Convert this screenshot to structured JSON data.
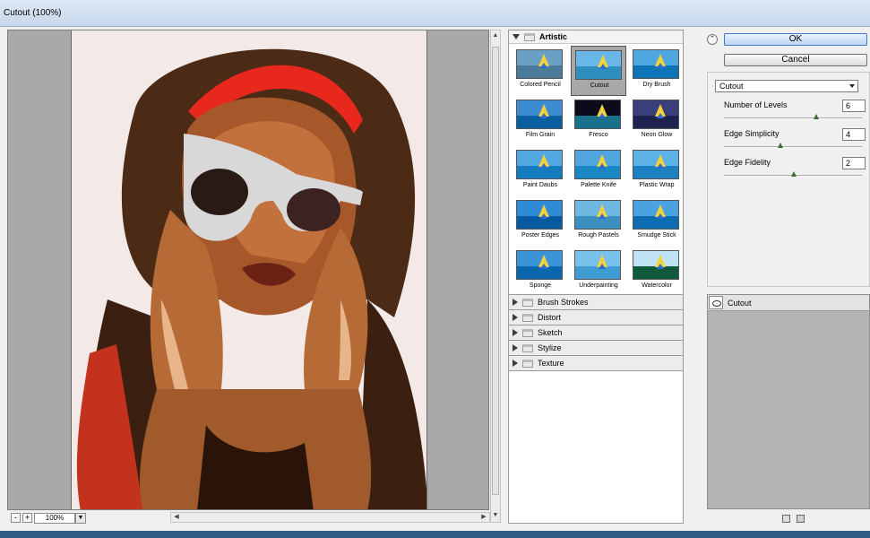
{
  "window": {
    "title": "Cutout (100%)"
  },
  "preview": {
    "zoom_value": "100%",
    "zoom_out_label": "-",
    "zoom_in_label": "+",
    "zoom_dropdown_icon": "chevron-down-icon"
  },
  "gallery": {
    "open_category": "Artistic",
    "thumbnails": [
      {
        "label": "Colored Pencil",
        "sky": "#6aa0c4",
        "sea": "#4c7b9a",
        "selected": false
      },
      {
        "label": "Cutout",
        "sky": "#69b7e6",
        "sea": "#2f8ec0",
        "selected": true
      },
      {
        "label": "Dry Brush",
        "sky": "#4fa7e1",
        "sea": "#0f74b6",
        "selected": false
      },
      {
        "label": "Film Grain",
        "sky": "#3d8bd0",
        "sea": "#0a5fa0",
        "selected": false
      },
      {
        "label": "Fresco",
        "sky": "#0b0b1c",
        "sea": "#1a6f8a",
        "selected": false
      },
      {
        "label": "Neon Glow",
        "sky": "#3a3f7c",
        "sea": "#1d2250",
        "selected": false
      },
      {
        "label": "Paint Daubs",
        "sky": "#53a8e2",
        "sea": "#137cbf",
        "selected": false
      },
      {
        "label": "Palette Knife",
        "sky": "#52a6df",
        "sea": "#1a86c4",
        "selected": false
      },
      {
        "label": "Plastic Wrap",
        "sky": "#5db2e8",
        "sea": "#1d80c0",
        "selected": false
      },
      {
        "label": "Poster Edges",
        "sky": "#2f8ad6",
        "sea": "#085aa0",
        "selected": false
      },
      {
        "label": "Rough Pastels",
        "sky": "#6fb6e0",
        "sea": "#3d8fc0",
        "selected": false
      },
      {
        "label": "Smudge Stick",
        "sky": "#4aa2e0",
        "sea": "#0e6db0",
        "selected": false
      },
      {
        "label": "Sponge",
        "sky": "#3c94d8",
        "sea": "#0a66ad",
        "selected": false
      },
      {
        "label": "Underpainting",
        "sky": "#79c0ea",
        "sea": "#3f9bd0",
        "selected": false
      },
      {
        "label": "Watercolor",
        "sky": "#bfe3f5",
        "sea": "#0e5a3a",
        "selected": false
      }
    ],
    "collapsed_categories": [
      "Brush Strokes",
      "Distort",
      "Sketch",
      "Stylize",
      "Texture"
    ]
  },
  "buttons": {
    "ok": "OK",
    "cancel": "Cancel"
  },
  "settings": {
    "filter_select": "Cutout",
    "params": [
      {
        "label": "Number of Levels",
        "value": "6",
        "min": 2,
        "max": 8
      },
      {
        "label": "Edge Simplicity",
        "value": "4",
        "min": 0,
        "max": 10
      },
      {
        "label": "Edge Fidelity",
        "value": "2",
        "min": 1,
        "max": 3
      }
    ]
  },
  "effects": {
    "layer_label": "Cutout"
  },
  "colors": {
    "accent": "#3a7bd5",
    "panel_bg": "#f0f0f0",
    "effects_bg": "#b4b4b4"
  }
}
